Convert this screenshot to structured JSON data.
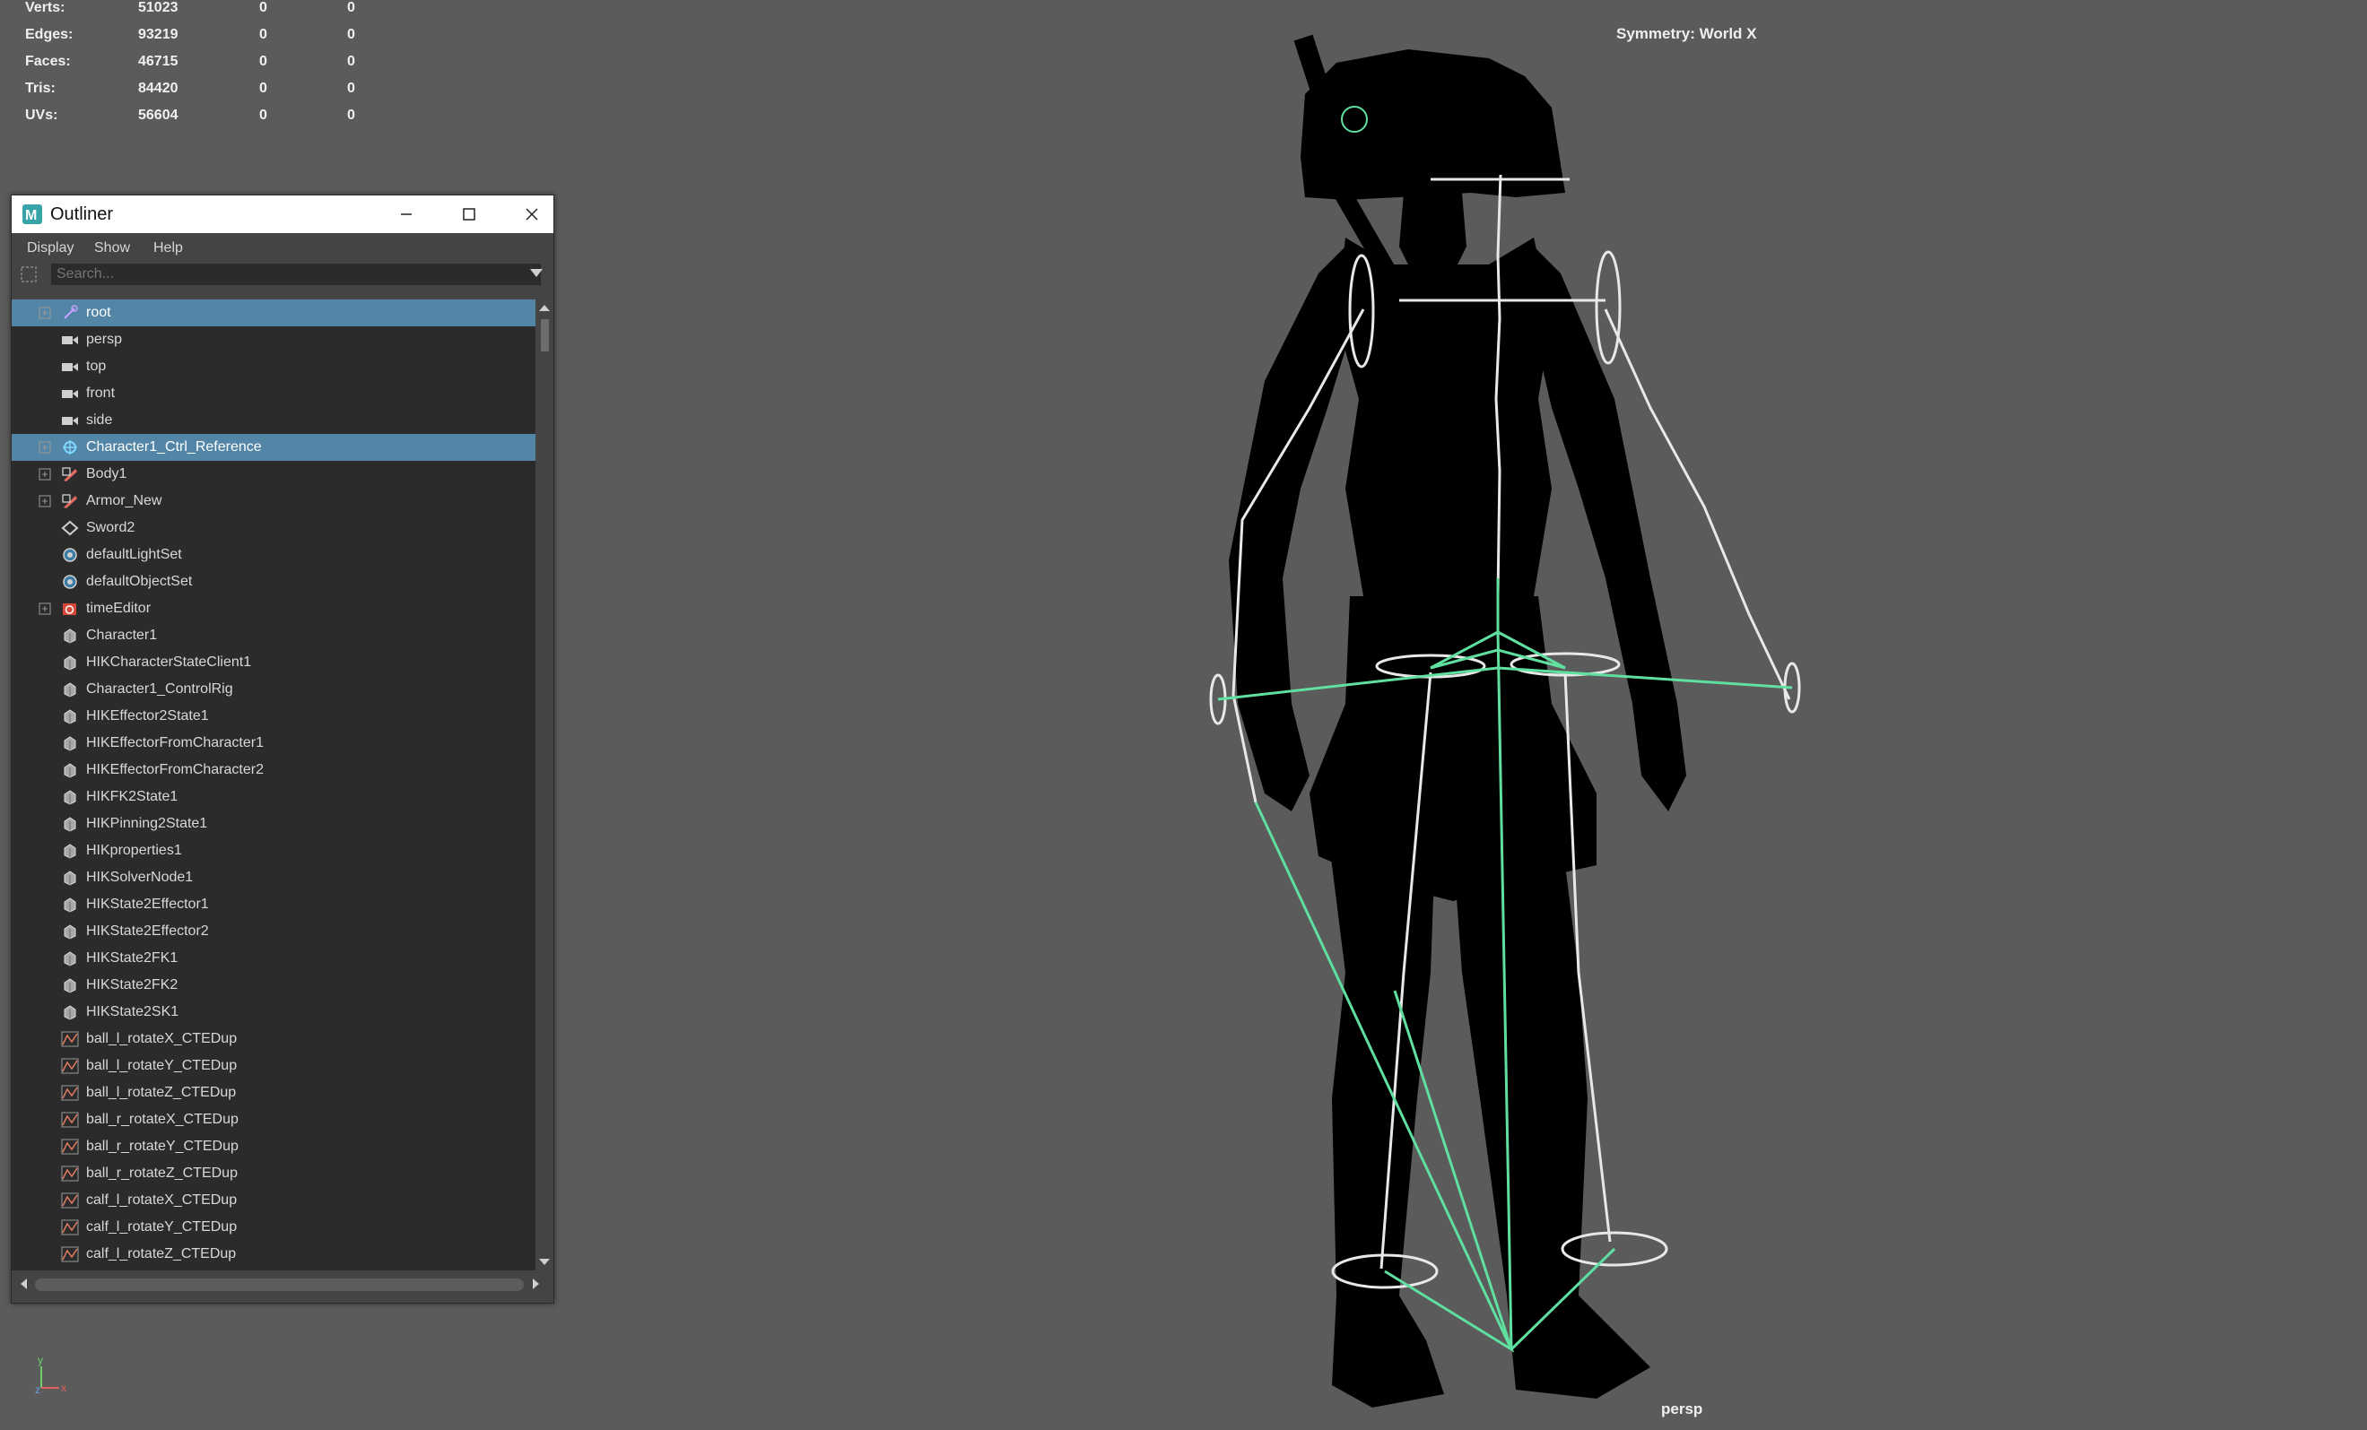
{
  "hud": {
    "stats": [
      {
        "label": "Verts:",
        "v1": "51023",
        "v2": "0",
        "v3": "0"
      },
      {
        "label": "Edges:",
        "v1": "93219",
        "v2": "0",
        "v3": "0"
      },
      {
        "label": "Faces:",
        "v1": "46715",
        "v2": "0",
        "v3": "0"
      },
      {
        "label": "Tris:",
        "v1": "84420",
        "v2": "0",
        "v3": "0"
      },
      {
        "label": "UVs:",
        "v1": "56604",
        "v2": "0",
        "v3": "0"
      }
    ],
    "symmetry": "Symmetry: World X",
    "camera": "persp"
  },
  "colors": {
    "viewport_bg": "#5b5b5b",
    "selection": "#5285a6",
    "skeleton_white": "#e8e8e8",
    "control_rig_green": "#5fe0a0",
    "silhouette": "#000000"
  },
  "outliner": {
    "title": "Outliner",
    "app_icon": "maya-icon",
    "menu": [
      "Display",
      "Show",
      "Help"
    ],
    "search_placeholder": "Search...",
    "items": [
      {
        "label": "root",
        "icon": "joint-icon",
        "expandable": true,
        "selected": true
      },
      {
        "label": "persp",
        "icon": "camera-icon",
        "expandable": false,
        "selected": false
      },
      {
        "label": "top",
        "icon": "camera-icon",
        "expandable": false,
        "selected": false
      },
      {
        "label": "front",
        "icon": "camera-icon",
        "expandable": false,
        "selected": false
      },
      {
        "label": "side",
        "icon": "camera-icon",
        "expandable": false,
        "selected": false
      },
      {
        "label": "Character1_Ctrl_Reference",
        "icon": "hik-reference-icon",
        "expandable": true,
        "selected": true
      },
      {
        "label": "Body1",
        "icon": "mesh-group-icon",
        "expandable": true,
        "selected": false
      },
      {
        "label": "Armor_New",
        "icon": "mesh-group-icon",
        "expandable": true,
        "selected": false
      },
      {
        "label": "Sword2",
        "icon": "mesh-icon",
        "expandable": false,
        "selected": false
      },
      {
        "label": "defaultLightSet",
        "icon": "set-icon",
        "expandable": false,
        "selected": false
      },
      {
        "label": "defaultObjectSet",
        "icon": "set-icon",
        "expandable": false,
        "selected": false
      },
      {
        "label": "timeEditor",
        "icon": "time-editor-icon",
        "expandable": true,
        "selected": false
      },
      {
        "label": "Character1",
        "icon": "node-icon",
        "expandable": false,
        "selected": false
      },
      {
        "label": "HIKCharacterStateClient1",
        "icon": "node-icon",
        "expandable": false,
        "selected": false
      },
      {
        "label": "Character1_ControlRig",
        "icon": "node-icon",
        "expandable": false,
        "selected": false
      },
      {
        "label": "HIKEffector2State1",
        "icon": "node-icon",
        "expandable": false,
        "selected": false
      },
      {
        "label": "HIKEffectorFromCharacter1",
        "icon": "node-icon",
        "expandable": false,
        "selected": false
      },
      {
        "label": "HIKEffectorFromCharacter2",
        "icon": "node-icon",
        "expandable": false,
        "selected": false
      },
      {
        "label": "HIKFK2State1",
        "icon": "node-icon",
        "expandable": false,
        "selected": false
      },
      {
        "label": "HIKPinning2State1",
        "icon": "node-icon",
        "expandable": false,
        "selected": false
      },
      {
        "label": "HIKproperties1",
        "icon": "node-icon",
        "expandable": false,
        "selected": false
      },
      {
        "label": "HIKSolverNode1",
        "icon": "node-icon",
        "expandable": false,
        "selected": false
      },
      {
        "label": "HIKState2Effector1",
        "icon": "node-icon",
        "expandable": false,
        "selected": false
      },
      {
        "label": "HIKState2Effector2",
        "icon": "node-icon",
        "expandable": false,
        "selected": false
      },
      {
        "label": "HIKState2FK1",
        "icon": "node-icon",
        "expandable": false,
        "selected": false
      },
      {
        "label": "HIKState2FK2",
        "icon": "node-icon",
        "expandable": false,
        "selected": false
      },
      {
        "label": "HIKState2SK1",
        "icon": "node-icon",
        "expandable": false,
        "selected": false
      },
      {
        "label": "ball_l_rotateX_CTEDup",
        "icon": "anim-curve-icon",
        "expandable": false,
        "selected": false
      },
      {
        "label": "ball_l_rotateY_CTEDup",
        "icon": "anim-curve-icon",
        "expandable": false,
        "selected": false
      },
      {
        "label": "ball_l_rotateZ_CTEDup",
        "icon": "anim-curve-icon",
        "expandable": false,
        "selected": false
      },
      {
        "label": "ball_r_rotateX_CTEDup",
        "icon": "anim-curve-icon",
        "expandable": false,
        "selected": false
      },
      {
        "label": "ball_r_rotateY_CTEDup",
        "icon": "anim-curve-icon",
        "expandable": false,
        "selected": false
      },
      {
        "label": "ball_r_rotateZ_CTEDup",
        "icon": "anim-curve-icon",
        "expandable": false,
        "selected": false
      },
      {
        "label": "calf_l_rotateX_CTEDup",
        "icon": "anim-curve-icon",
        "expandable": false,
        "selected": false
      },
      {
        "label": "calf_l_rotateY_CTEDup",
        "icon": "anim-curve-icon",
        "expandable": false,
        "selected": false
      },
      {
        "label": "calf_l_rotateZ_CTEDup",
        "icon": "anim-curve-icon",
        "expandable": false,
        "selected": false
      }
    ]
  }
}
